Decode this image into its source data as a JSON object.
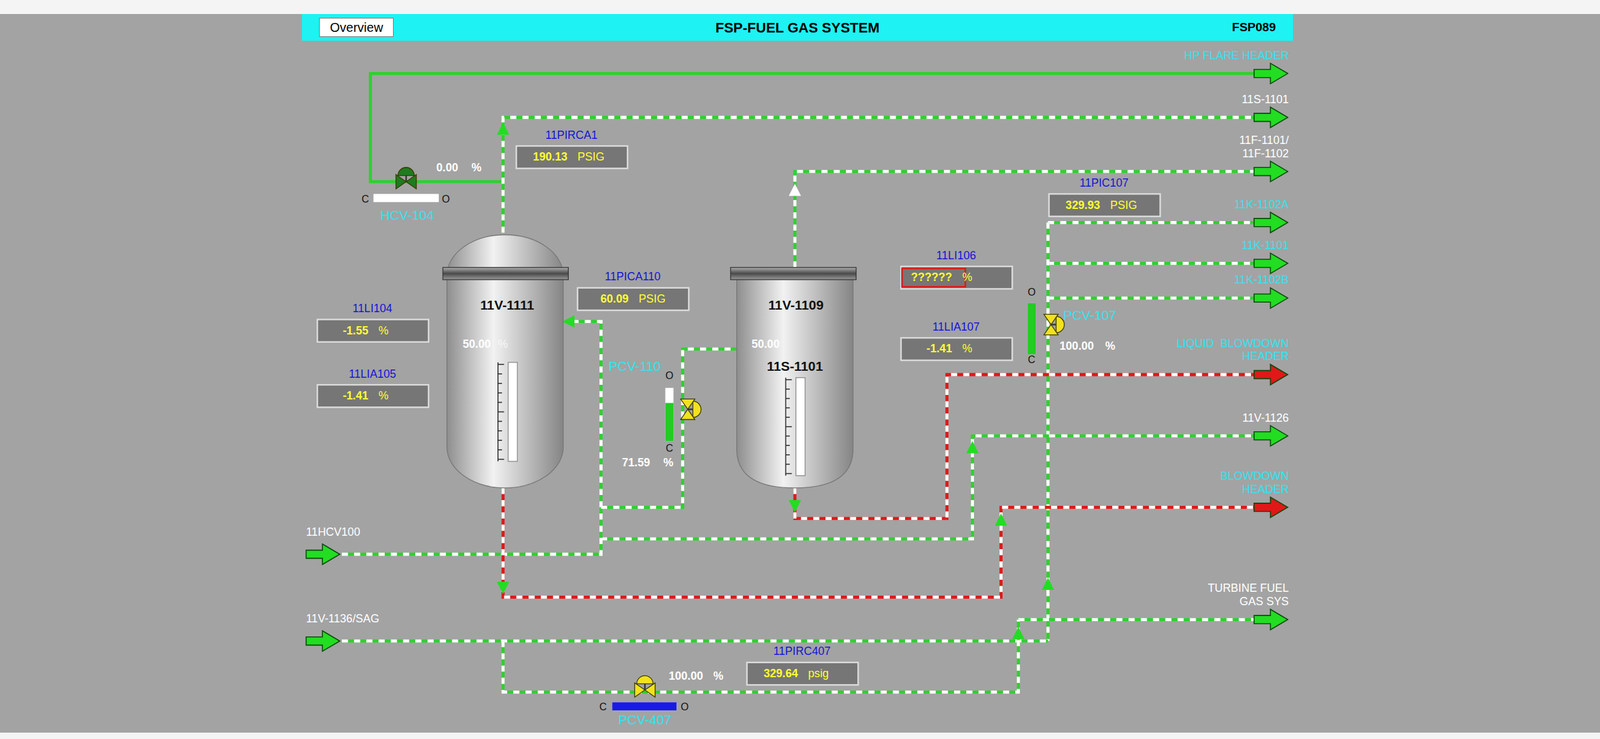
{
  "header": {
    "button": "Overview",
    "title": "FSP-FUEL GAS SYSTEM",
    "screen_id": "FSP089"
  },
  "vessels": [
    {
      "name": "11V-1111",
      "reading": "50.00",
      "unit": "%"
    },
    {
      "name": "11V-1109",
      "reading": "50.00",
      "subtitle": "11S-1101"
    }
  ],
  "indicators": [
    {
      "tag": "11PIRCA1",
      "value": "190.13",
      "unit": "PSIG",
      "alarm": false
    },
    {
      "tag": "11PICA110",
      "value": "60.09",
      "unit": "PSIG",
      "alarm": false
    },
    {
      "tag": "11LI104",
      "value": "-1.55",
      "unit": "%",
      "alarm": false
    },
    {
      "tag": "11LIA105",
      "value": "-1.41",
      "unit": "%",
      "alarm": false
    },
    {
      "tag": "11LI106",
      "value": "??????",
      "unit": "%",
      "alarm": true
    },
    {
      "tag": "11LIA107",
      "value": "-1.41",
      "unit": "%",
      "alarm": false
    },
    {
      "tag": "11PIC107",
      "value": "329.93",
      "unit": "PSIG",
      "alarm": false
    },
    {
      "tag": "11PIRC407",
      "value": "329.64",
      "unit": "psig",
      "alarm": false
    }
  ],
  "valves": [
    {
      "name": "HCV-104",
      "position": "0.00",
      "unit": "%",
      "level": 0,
      "open_label": "O",
      "closed_label": "C",
      "color": "#1e7b1e",
      "bar_color": "#22cc22"
    },
    {
      "name": "PCV-110",
      "position": "71.59",
      "unit": "%",
      "level": 0.7159,
      "open_label": "O",
      "closed_label": "C",
      "color": "#f2e21c",
      "bar_color": "#22cc22"
    },
    {
      "name": "PCV-107",
      "position": "100.00",
      "unit": "%",
      "level": 1,
      "open_label": "O",
      "closed_label": "C",
      "color": "#f2e21c",
      "bar_color": "#22cc22"
    },
    {
      "name": "PCV-407",
      "position": "100.00",
      "unit": "%",
      "level": 1,
      "open_label": "O",
      "closed_label": "C",
      "color": "#f2e21c",
      "bar_color": "#1a1ae6"
    }
  ],
  "destinations": [
    {
      "lines": [
        "HP FLARE HEADER"
      ],
      "color": "#35e3f0",
      "arrow_color": "#22dd22"
    },
    {
      "lines": [
        "11S-1101"
      ],
      "color": "#ffffff",
      "arrow_color": "#22dd22"
    },
    {
      "lines": [
        "11F-1101/",
        "11F-1102"
      ],
      "color": "#ffffff",
      "arrow_color": "#22dd22"
    },
    {
      "lines": [
        "11K-1102A"
      ],
      "color": "#35e3f0",
      "arrow_color": "#22dd22"
    },
    {
      "lines": [
        "11K-1101"
      ],
      "color": "#35e3f0",
      "arrow_color": "#22dd22"
    },
    {
      "lines": [
        "11K-1102B"
      ],
      "color": "#35e3f0",
      "arrow_color": "#22dd22"
    },
    {
      "lines": [
        "LIQUID  BLOWDOWN",
        "HEADER"
      ],
      "color": "#35e3f0",
      "arrow_color": "#e01818"
    },
    {
      "lines": [
        "11V-1126"
      ],
      "color": "#ffffff",
      "arrow_color": "#22dd22"
    },
    {
      "lines": [
        "BLOWDOWN",
        "HEADER"
      ],
      "color": "#35e3f0",
      "arrow_color": "#e01818"
    },
    {
      "lines": [
        "TURBINE FUEL",
        "GAS SYS"
      ],
      "color": "#ffffff",
      "arrow_color": "#22dd22"
    }
  ],
  "sources": [
    {
      "label": "11HCV100"
    },
    {
      "label": "11V-1136/SAG"
    }
  ]
}
